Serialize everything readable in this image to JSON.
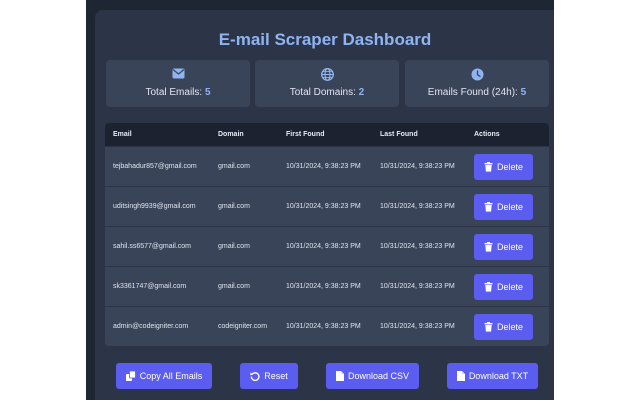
{
  "header": {
    "title": "E-mail Scraper Dashboard"
  },
  "stats": [
    {
      "label": "Total Emails:",
      "value": "5",
      "icon": "envelope-icon"
    },
    {
      "label": "Total Domains:",
      "value": "2",
      "icon": "globe-icon"
    },
    {
      "label": "Emails Found (24h):",
      "value": "5",
      "icon": "clock-icon"
    }
  ],
  "table": {
    "columns": [
      "Email",
      "Domain",
      "First Found",
      "Last Found",
      "Actions"
    ],
    "delete_label": "Delete",
    "rows": [
      {
        "email": "tejbahadur857@gmail.com",
        "domain": "gmail.com",
        "first": "10/31/2024, 9:38:23 PM",
        "last": "10/31/2024, 9:38:23 PM"
      },
      {
        "email": "uditsingh9939@gmail.com",
        "domain": "gmail.com",
        "first": "10/31/2024, 9:38:23 PM",
        "last": "10/31/2024, 9:38:23 PM"
      },
      {
        "email": "sahil.ss6577@gmail.com",
        "domain": "gmail.com",
        "first": "10/31/2024, 9:38:23 PM",
        "last": "10/31/2024, 9:38:23 PM"
      },
      {
        "email": "sk3361747@gmail.com",
        "domain": "gmail.com",
        "first": "10/31/2024, 9:38:23 PM",
        "last": "10/31/2024, 9:38:23 PM"
      },
      {
        "email": "admin@codeigniter.com",
        "domain": "codeigniter.com",
        "first": "10/31/2024, 9:38:23 PM",
        "last": "10/31/2024, 9:38:23 PM"
      }
    ]
  },
  "actions": {
    "copy_all": "Copy All Emails",
    "reset": "Reset",
    "download_csv": "Download CSV",
    "download_txt": "Download TXT"
  },
  "colors": {
    "accent": "#5b5cf0",
    "title": "#8fb4f2",
    "panel": "#2c3547",
    "card": "#3a4459",
    "header_row": "#1d2231",
    "background": "#1e2533"
  }
}
